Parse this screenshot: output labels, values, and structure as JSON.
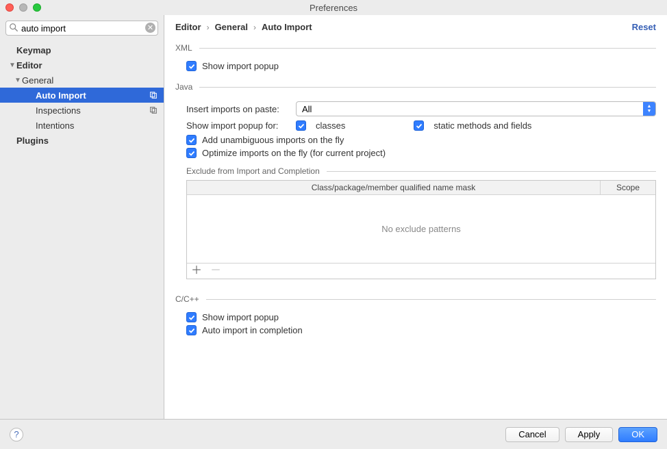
{
  "window": {
    "title": "Preferences"
  },
  "search": {
    "value": "auto import"
  },
  "sidebar": {
    "items": [
      {
        "label": "Keymap",
        "bold": true,
        "indent": 0,
        "selected": false,
        "disclosure": "",
        "trailing": ""
      },
      {
        "label": "Editor",
        "bold": true,
        "indent": 0,
        "selected": false,
        "disclosure": "▼",
        "trailing": ""
      },
      {
        "label": "General",
        "bold": false,
        "indent": 1,
        "selected": false,
        "disclosure": "▼",
        "trailing": ""
      },
      {
        "label": "Auto Import",
        "bold": true,
        "indent": 2,
        "selected": true,
        "disclosure": "",
        "trailing": "copy"
      },
      {
        "label": "Inspections",
        "bold": false,
        "indent": 2,
        "selected": false,
        "disclosure": "",
        "trailing": "copy"
      },
      {
        "label": "Intentions",
        "bold": false,
        "indent": 2,
        "selected": false,
        "disclosure": "",
        "trailing": ""
      },
      {
        "label": "Plugins",
        "bold": true,
        "indent": 0,
        "selected": false,
        "disclosure": "",
        "trailing": ""
      }
    ]
  },
  "breadcrumb": [
    "Editor",
    "General",
    "Auto Import"
  ],
  "reset_label": "Reset",
  "xml": {
    "section_title": "XML",
    "show_popup": {
      "label": "Show import popup",
      "checked": true
    }
  },
  "java": {
    "section_title": "Java",
    "insert_label": "Insert imports on paste:",
    "insert_value": "All",
    "popup_label": "Show import popup for:",
    "popup_classes": {
      "label": "classes",
      "checked": true
    },
    "popup_static": {
      "label": "static methods and fields",
      "checked": true
    },
    "unambiguous": {
      "label": "Add unambiguous imports on the fly",
      "checked": true
    },
    "optimize": {
      "label": "Optimize imports on the fly (for current project)",
      "checked": true
    },
    "exclude": {
      "subtitle": "Exclude from Import and Completion",
      "th1": "Class/package/member qualified name mask",
      "th2": "Scope",
      "empty": "No exclude patterns"
    }
  },
  "cpp": {
    "section_title": "C/C++",
    "show_popup": {
      "label": "Show import popup",
      "checked": true
    },
    "auto_completion": {
      "label": "Auto import in completion",
      "checked": true
    }
  },
  "footer": {
    "help": "?",
    "cancel": "Cancel",
    "apply": "Apply",
    "ok": "OK"
  }
}
